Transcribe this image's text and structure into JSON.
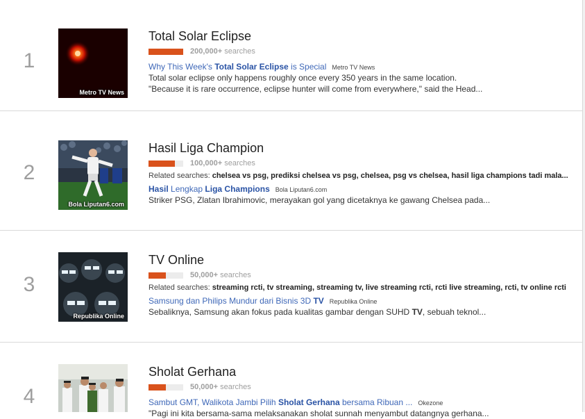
{
  "items": [
    {
      "rank": "1",
      "title": "Total Solar Eclipse",
      "count": "200,000+",
      "count_suffix": "searches",
      "fill": 1.0,
      "thumb_caption": "Metro TV News",
      "news_prefix": "Why This Week's ",
      "news_bold": "Total Solar Eclipse",
      "news_suffix": " is Special",
      "news_source": "Metro TV News",
      "snippet1": "Total solar eclipse only happens roughly once every 350 years in the same location.",
      "snippet2": "\"Because it is rare occurrence, eclipse hunter will come from everywhere,\" said the Head..."
    },
    {
      "rank": "2",
      "title": "Hasil Liga Champion",
      "count": "100,000+",
      "count_suffix": "searches",
      "fill": 0.75,
      "thumb_caption": "Bola Liputan6.com",
      "related_label": "Related searches: ",
      "related_terms": "chelsea vs psg, prediksi chelsea vs psg, chelsea, psg vs chelsea, hasil liga champions tadi mala...",
      "news_bold1": "Hasil",
      "news_mid": " Lengkap ",
      "news_bold2": "Liga Champions",
      "news_source": "Bola Liputan6.com",
      "snippet1": "Striker PSG, Zlatan Ibrahimovic, merayakan gol yang dicetaknya ke gawang Chelsea pada..."
    },
    {
      "rank": "3",
      "title": "TV Online",
      "count": "50,000+",
      "count_suffix": "searches",
      "fill": 0.5,
      "thumb_caption": "Republika Online",
      "related_label": "Related searches: ",
      "related_terms": "streaming rcti, tv streaming, streaming tv, live streaming rcti, rcti live streaming, rcti, tv online rcti",
      "news_prefix": "Samsung dan Philips Mundur dari Bisnis 3D ",
      "news_bold": "TV",
      "news_source": "Republika Online",
      "snippet_prefix": "Sebaliknya, Samsung akan fokus pada kualitas gambar dengan SUHD ",
      "snippet_bold": "TV",
      "snippet_suffix": ", sebuah teknol..."
    },
    {
      "rank": "4",
      "title": "Sholat Gerhana",
      "count": "50,000+",
      "count_suffix": "searches",
      "fill": 0.5,
      "news_prefix": "Sambut GMT, Walikota Jambi Pilih ",
      "news_bold": "Sholat Gerhana",
      "news_suffix": " bersama Ribuan ...",
      "news_source": "Okezone",
      "snippet1": "\"Pagi ini kita bersama-sama melaksanakan sholat sunnah menyambut datangnya gerhana..."
    }
  ],
  "colors": {
    "bar": "#d9521c",
    "link": "#3f68b8",
    "rank": "#9e9e9e"
  }
}
